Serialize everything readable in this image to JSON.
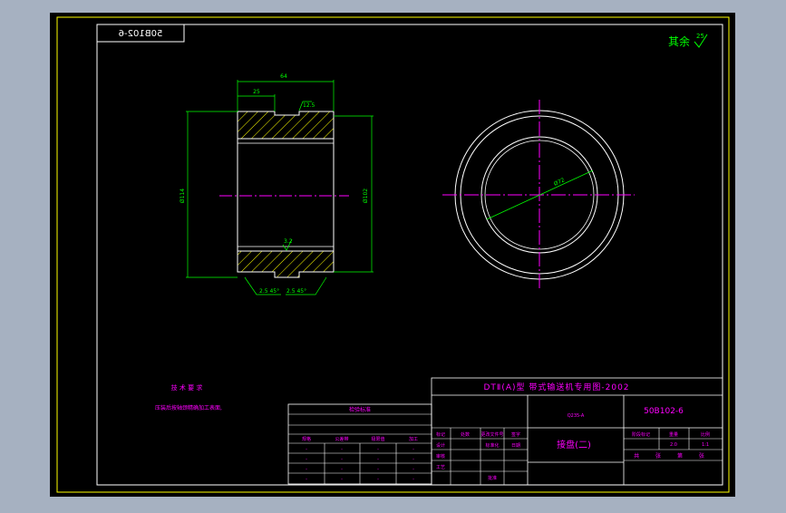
{
  "drawing": {
    "number_stamp": "50B102-6",
    "surface_finish_note": "其余",
    "surface_finish_value": "25"
  },
  "dimensions": {
    "overall_width": "64",
    "step_width": "25",
    "chamfer_roughness": "12.5",
    "inner_roughness": "3.2",
    "left_diameter": "Ø114",
    "right_diameter": "Ø102",
    "chamfer_left": "2.5 45°",
    "chamfer_right": "2.5 45°",
    "radial_dim": "Ø72"
  },
  "technical_requirements": {
    "title": "技 术 要 求",
    "line1": "压装后按轴颈精确加工表面,"
  },
  "spec_table": {
    "title": "检验标准",
    "rows": [
      [
        "规格",
        "公差带",
        "极限值",
        "加工",
        "公差"
      ],
      [
        "-",
        "-",
        "-",
        "-",
        "-"
      ],
      [
        "-",
        "-",
        "-",
        "-",
        "-"
      ],
      [
        "-",
        "-",
        "-",
        "-",
        "-"
      ],
      [
        "-",
        "-",
        "-",
        "-",
        "-"
      ]
    ]
  },
  "title_block": {
    "project": "DTⅡ(A)型 带式输送机专用图-2002",
    "drawing_no": "50B102-6",
    "part_name": "接盘(二)",
    "material": "Q235-A",
    "scale": "1:1",
    "weight": "2.0",
    "sheet": "共 张 第 张",
    "labels": [
      "标记",
      "处数",
      "更改文件号",
      "签字",
      "日期",
      "设计",
      "审核",
      "工艺",
      "标准化",
      "批准"
    ],
    "right_labels": [
      "阶段标记",
      "重量",
      "比例"
    ]
  },
  "colors": {
    "frame": "#ffff00",
    "outline": "#ffffff",
    "dimension": "#00ff00",
    "centerline": "#ff00ff",
    "hatch": "#ffff00",
    "title_text": "#ff00ff",
    "title_lines": "#ffffff"
  }
}
